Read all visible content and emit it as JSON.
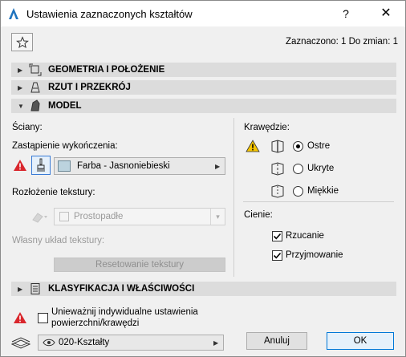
{
  "window": {
    "title": "Ustawienia zaznaczonych kształtów",
    "help": "?",
    "close": "✕"
  },
  "header": {
    "selection_info": "Zaznaczono: 1 Do zmian: 1"
  },
  "sections": {
    "geometry": "GEOMETRIA I POŁOŻENIE",
    "plan_section": "RZUT I PRZEKRÓJ",
    "model": "MODEL",
    "classification": "KLASYFIKACJA I WŁAŚCIWOŚCI"
  },
  "model": {
    "faces_label": "Ściany:",
    "override_label": "Zastąpienie wykończenia:",
    "surface_name": "Farba - Jasnoniebieski",
    "texture_distribution_label": "Rozłożenie tekstury:",
    "texture_distribution_value": "Prostopadłe",
    "custom_texture_label": "Własny układ tekstury:",
    "reset_texture_button": "Resetowanie tekstury",
    "edges_label": "Krawędzie:",
    "edges": [
      {
        "label": "Ostre",
        "selected": true
      },
      {
        "label": "Ukryte",
        "selected": false
      },
      {
        "label": "Miękkie",
        "selected": false
      }
    ],
    "shadows_label": "Cienie:",
    "shadows": [
      {
        "label": "Rzucanie",
        "checked": true
      },
      {
        "label": "Przyjmowanie",
        "checked": true
      }
    ]
  },
  "footer": {
    "override_line1": "Unieważnij indywidualne ustawienia",
    "override_line2": "powierzchni/krawędzi",
    "layer_value": "020-Kształty",
    "cancel_button": "Anuluj",
    "ok_button": "OK"
  },
  "colors": {
    "accent": "#0078d7",
    "warning": "#d9262c",
    "caution": "#f5c400",
    "section_bar": "#dcdcdc"
  }
}
